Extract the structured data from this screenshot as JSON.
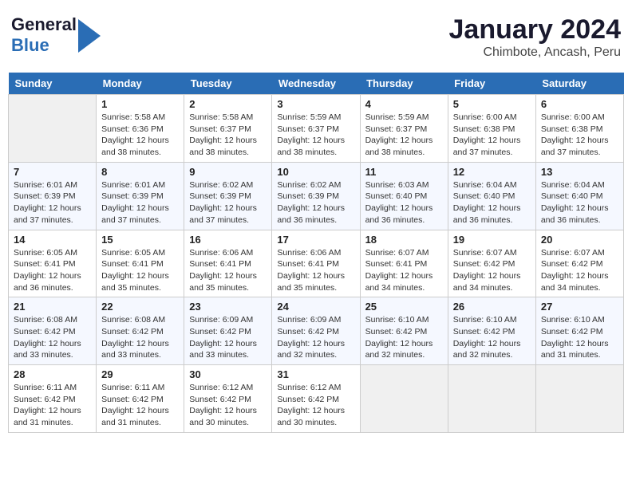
{
  "header": {
    "logo_general": "General",
    "logo_blue": "Blue",
    "month_title": "January 2024",
    "location": "Chimbote, Ancash, Peru"
  },
  "days_of_week": [
    "Sunday",
    "Monday",
    "Tuesday",
    "Wednesday",
    "Thursday",
    "Friday",
    "Saturday"
  ],
  "weeks": [
    [
      {
        "num": "",
        "info": ""
      },
      {
        "num": "1",
        "info": "Sunrise: 5:58 AM\nSunset: 6:36 PM\nDaylight: 12 hours\nand 38 minutes."
      },
      {
        "num": "2",
        "info": "Sunrise: 5:58 AM\nSunset: 6:37 PM\nDaylight: 12 hours\nand 38 minutes."
      },
      {
        "num": "3",
        "info": "Sunrise: 5:59 AM\nSunset: 6:37 PM\nDaylight: 12 hours\nand 38 minutes."
      },
      {
        "num": "4",
        "info": "Sunrise: 5:59 AM\nSunset: 6:37 PM\nDaylight: 12 hours\nand 38 minutes."
      },
      {
        "num": "5",
        "info": "Sunrise: 6:00 AM\nSunset: 6:38 PM\nDaylight: 12 hours\nand 37 minutes."
      },
      {
        "num": "6",
        "info": "Sunrise: 6:00 AM\nSunset: 6:38 PM\nDaylight: 12 hours\nand 37 minutes."
      }
    ],
    [
      {
        "num": "7",
        "info": "Sunrise: 6:01 AM\nSunset: 6:39 PM\nDaylight: 12 hours\nand 37 minutes."
      },
      {
        "num": "8",
        "info": "Sunrise: 6:01 AM\nSunset: 6:39 PM\nDaylight: 12 hours\nand 37 minutes."
      },
      {
        "num": "9",
        "info": "Sunrise: 6:02 AM\nSunset: 6:39 PM\nDaylight: 12 hours\nand 37 minutes."
      },
      {
        "num": "10",
        "info": "Sunrise: 6:02 AM\nSunset: 6:39 PM\nDaylight: 12 hours\nand 36 minutes."
      },
      {
        "num": "11",
        "info": "Sunrise: 6:03 AM\nSunset: 6:40 PM\nDaylight: 12 hours\nand 36 minutes."
      },
      {
        "num": "12",
        "info": "Sunrise: 6:04 AM\nSunset: 6:40 PM\nDaylight: 12 hours\nand 36 minutes."
      },
      {
        "num": "13",
        "info": "Sunrise: 6:04 AM\nSunset: 6:40 PM\nDaylight: 12 hours\nand 36 minutes."
      }
    ],
    [
      {
        "num": "14",
        "info": "Sunrise: 6:05 AM\nSunset: 6:41 PM\nDaylight: 12 hours\nand 36 minutes."
      },
      {
        "num": "15",
        "info": "Sunrise: 6:05 AM\nSunset: 6:41 PM\nDaylight: 12 hours\nand 35 minutes."
      },
      {
        "num": "16",
        "info": "Sunrise: 6:06 AM\nSunset: 6:41 PM\nDaylight: 12 hours\nand 35 minutes."
      },
      {
        "num": "17",
        "info": "Sunrise: 6:06 AM\nSunset: 6:41 PM\nDaylight: 12 hours\nand 35 minutes."
      },
      {
        "num": "18",
        "info": "Sunrise: 6:07 AM\nSunset: 6:41 PM\nDaylight: 12 hours\nand 34 minutes."
      },
      {
        "num": "19",
        "info": "Sunrise: 6:07 AM\nSunset: 6:42 PM\nDaylight: 12 hours\nand 34 minutes."
      },
      {
        "num": "20",
        "info": "Sunrise: 6:07 AM\nSunset: 6:42 PM\nDaylight: 12 hours\nand 34 minutes."
      }
    ],
    [
      {
        "num": "21",
        "info": "Sunrise: 6:08 AM\nSunset: 6:42 PM\nDaylight: 12 hours\nand 33 minutes."
      },
      {
        "num": "22",
        "info": "Sunrise: 6:08 AM\nSunset: 6:42 PM\nDaylight: 12 hours\nand 33 minutes."
      },
      {
        "num": "23",
        "info": "Sunrise: 6:09 AM\nSunset: 6:42 PM\nDaylight: 12 hours\nand 33 minutes."
      },
      {
        "num": "24",
        "info": "Sunrise: 6:09 AM\nSunset: 6:42 PM\nDaylight: 12 hours\nand 32 minutes."
      },
      {
        "num": "25",
        "info": "Sunrise: 6:10 AM\nSunset: 6:42 PM\nDaylight: 12 hours\nand 32 minutes."
      },
      {
        "num": "26",
        "info": "Sunrise: 6:10 AM\nSunset: 6:42 PM\nDaylight: 12 hours\nand 32 minutes."
      },
      {
        "num": "27",
        "info": "Sunrise: 6:10 AM\nSunset: 6:42 PM\nDaylight: 12 hours\nand 31 minutes."
      }
    ],
    [
      {
        "num": "28",
        "info": "Sunrise: 6:11 AM\nSunset: 6:42 PM\nDaylight: 12 hours\nand 31 minutes."
      },
      {
        "num": "29",
        "info": "Sunrise: 6:11 AM\nSunset: 6:42 PM\nDaylight: 12 hours\nand 31 minutes."
      },
      {
        "num": "30",
        "info": "Sunrise: 6:12 AM\nSunset: 6:42 PM\nDaylight: 12 hours\nand 30 minutes."
      },
      {
        "num": "31",
        "info": "Sunrise: 6:12 AM\nSunset: 6:42 PM\nDaylight: 12 hours\nand 30 minutes."
      },
      {
        "num": "",
        "info": ""
      },
      {
        "num": "",
        "info": ""
      },
      {
        "num": "",
        "info": ""
      }
    ]
  ]
}
